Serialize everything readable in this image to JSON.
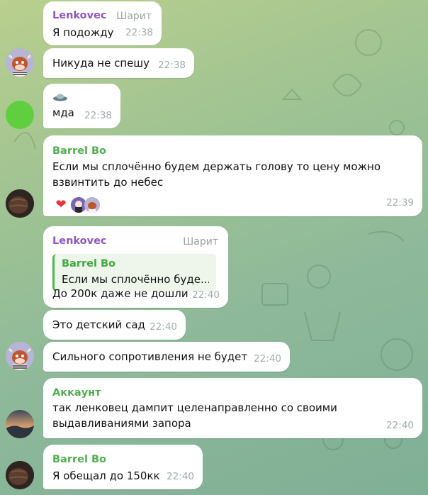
{
  "colors": {
    "name_lenkovec": "#8e56c8",
    "name_green": "#4fae4e",
    "time": "#a2abad",
    "role": "#9aa3a0"
  },
  "messages": [
    {
      "sender": "Lenkovec",
      "role": "Шарит",
      "text": "Я подожду",
      "time": "22:38"
    },
    {
      "text": "Никуда не спешу",
      "time": "22:38",
      "avatar": "cow-avatar"
    },
    {
      "icon": "ufo-icon",
      "text": "мда",
      "time": "22:38",
      "avatar": "green-circle-avatar"
    },
    {
      "sender": "Barrel Bo",
      "text_line1": "Если мы сплочённо будем держать голову то цену можно",
      "text_line2": "взвинтить до небес",
      "time": "22:39",
      "avatar": "barrel-avatar",
      "reactions": [
        "heart-reaction",
        "user-reaction-1",
        "user-reaction-2"
      ]
    },
    {
      "sender": "Lenkovec",
      "role": "Шарит",
      "reply_to": "Barrel Bo",
      "reply_text": "Если мы сплочённо буде...",
      "text": "До 200к даже не дошли",
      "time": "22:40"
    },
    {
      "text": "Это детский сад",
      "time": "22:40"
    },
    {
      "text": "Сильного сопротивления не будет",
      "time": "22:40",
      "avatar": "cow-avatar"
    },
    {
      "sender": "Аккаунт",
      "text_line1": "так ленковец дампит целенаправленно со своими",
      "text_line2": "выдавливаниями запора",
      "time": "22:40",
      "avatar": "landscape-avatar"
    },
    {
      "sender": "Barrel Bo",
      "text": "Я обещал до 150кк",
      "time": "22:40",
      "avatar": "barrel-avatar"
    }
  ]
}
